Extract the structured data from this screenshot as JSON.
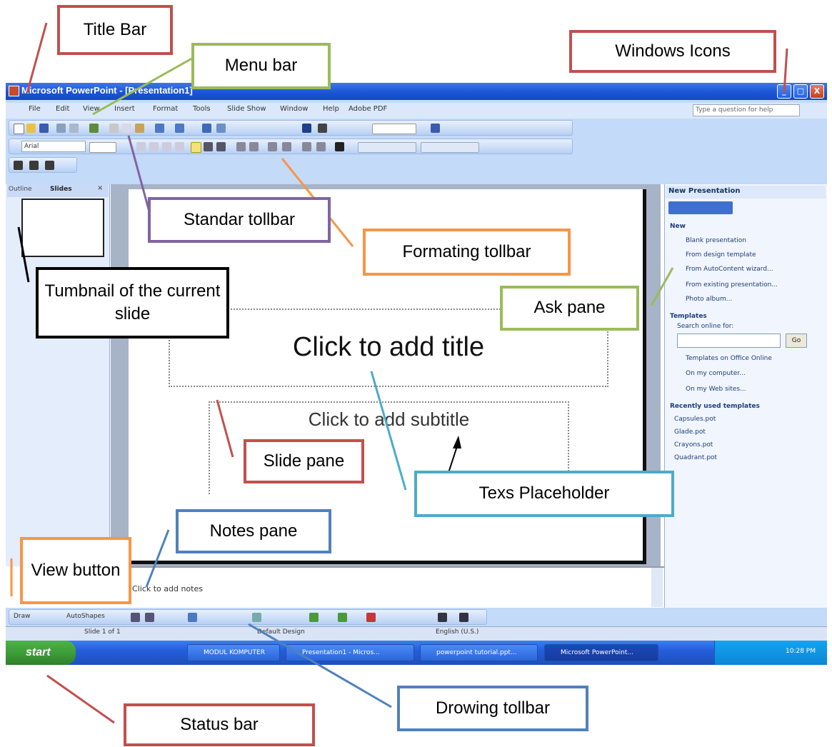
{
  "window": {
    "title": "Microsoft PowerPoint - [Presentation1]",
    "minimize_glyph": "_",
    "maximize_glyph": "□",
    "close_glyph": "X"
  },
  "menu": {
    "items": [
      "File",
      "Edit",
      "View",
      "Insert",
      "Format",
      "Tools",
      "Slide Show",
      "Window",
      "Help",
      "Adobe PDF"
    ],
    "ask_placeholder": "Type a question for help"
  },
  "formatting": {
    "font": "Arial"
  },
  "left_pane": {
    "tab_outline": "Outline",
    "tab_slides": "Slides",
    "close": "×"
  },
  "slide": {
    "title_placeholder": "Click to add title",
    "subtitle_placeholder": "Click to add subtitle"
  },
  "notes": {
    "placeholder": "Click to add notes"
  },
  "task_pane": {
    "title": "New Presentation",
    "new_header": "New",
    "new_items": [
      "Blank presentation",
      "From design template",
      "From AutoContent wizard...",
      "From existing presentation...",
      "Photo album..."
    ],
    "templates_header": "Templates",
    "search_label": "Search online for:",
    "go_button": "Go",
    "template_links": [
      "Templates on Office Online",
      "On my computer...",
      "On my Web sites..."
    ],
    "recent_header": "Recently used templates",
    "recent_items": [
      "Capsules.pot",
      "Glade.pot",
      "Crayons.pot",
      "Quadrant.pot"
    ]
  },
  "drawing_toolbar": {
    "draw_label": "Draw",
    "autoshapes_label": "AutoShapes"
  },
  "status_bar": {
    "slide": "Slide 1 of 1",
    "design": "Default Design",
    "language": "English (U.S.)"
  },
  "taskbar": {
    "start_label": "start",
    "tasks": [
      "MODUL KOMPUTER",
      "Presentation1 - Micros...",
      "powerpoint tutorial.ppt...",
      "Microsoft PowerPoint..."
    ],
    "clock": "10:28 PM"
  },
  "callouts": {
    "title_bar": "Title Bar",
    "menu_bar": "Menu bar",
    "windows_icons": "Windows Icons",
    "standard_toolbar": "Standar tollbar",
    "formatting_toolbar": "Formating tollbar",
    "thumbnail": "Tumbnail of the current slide",
    "ask_pane": "Ask pane",
    "slide_pane": "Slide pane",
    "text_placeholder": "Texs Placeholder",
    "notes_pane": "Notes pane",
    "view_button": "View button",
    "drawing_toolbar": "Drowing tollbar",
    "status_bar": "Status  bar"
  }
}
